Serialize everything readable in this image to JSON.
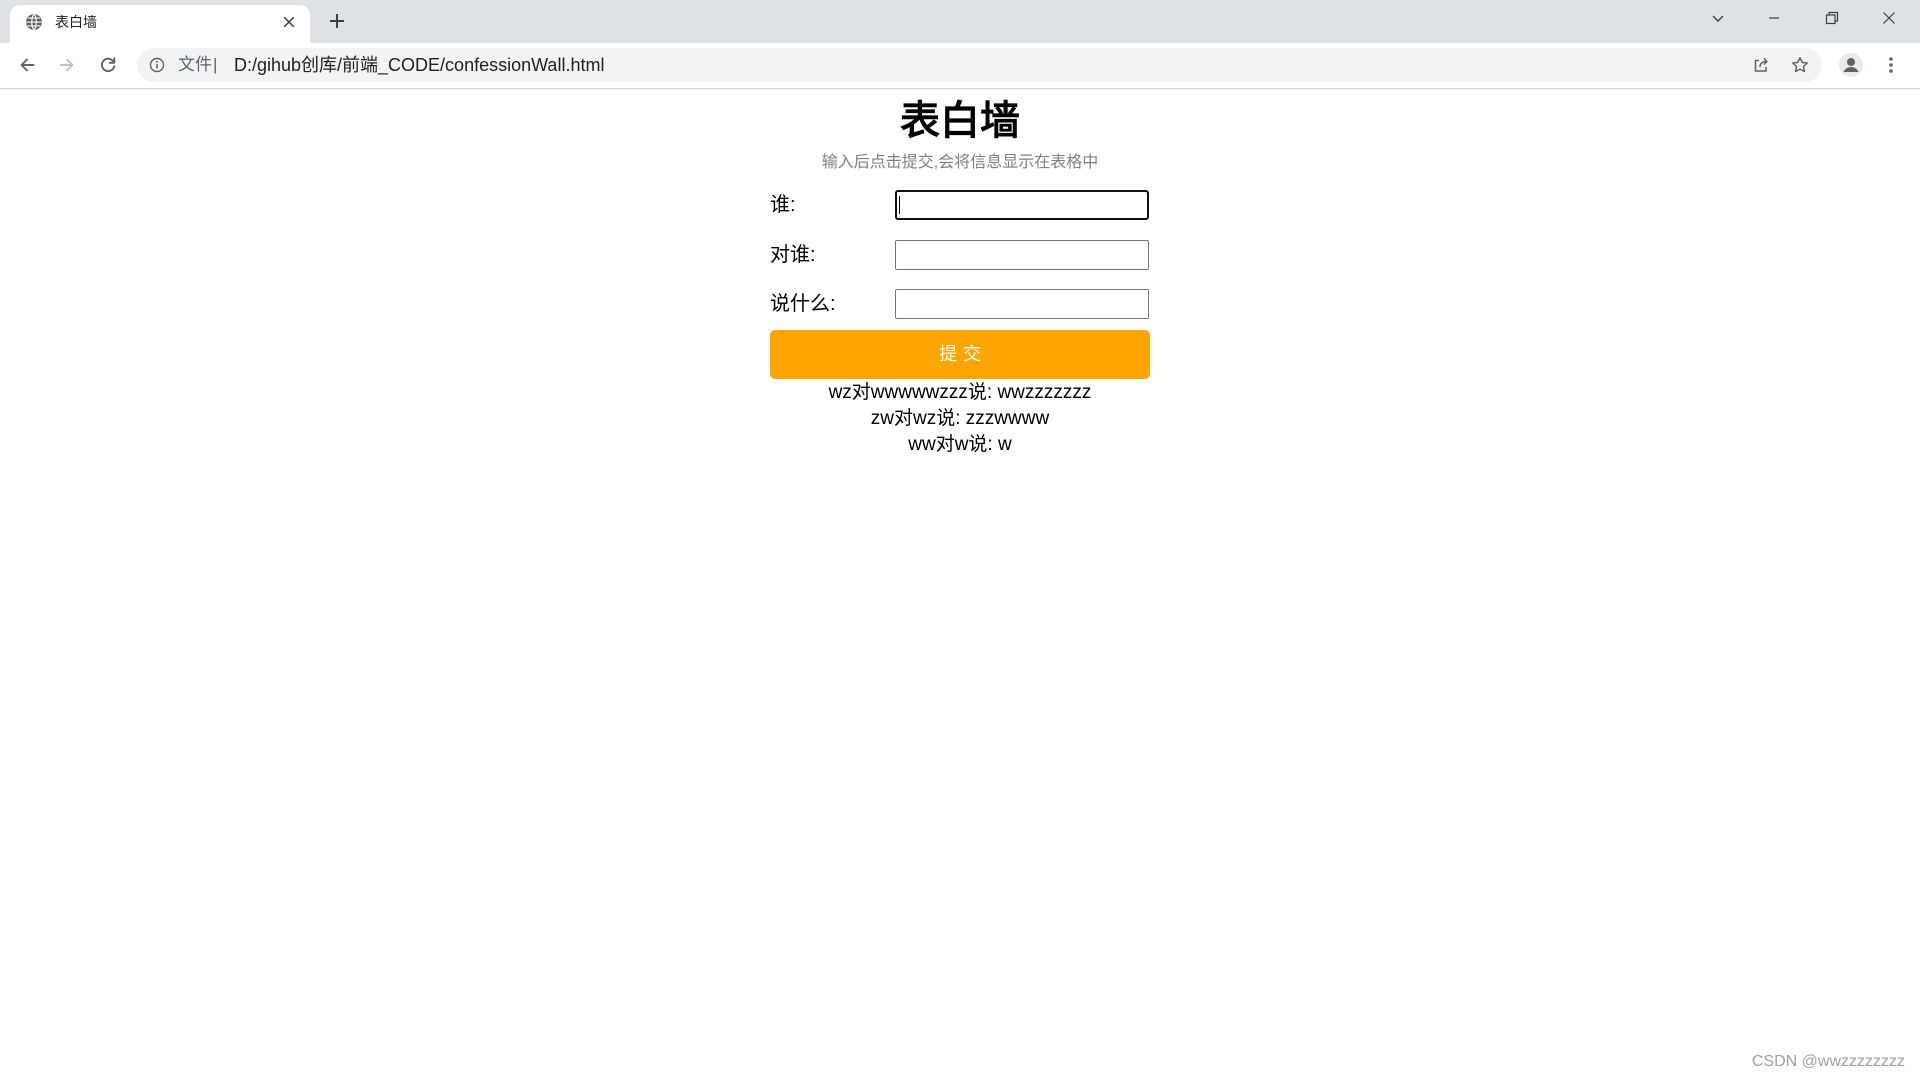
{
  "window": {
    "tab": {
      "title": "表白墙",
      "favicon": "globe-icon",
      "close_icon": "close-icon"
    },
    "new_tab_icon": "plus-icon",
    "controls": [
      "chevron-down-icon",
      "minimize-icon",
      "restore-icon",
      "window-close-icon"
    ]
  },
  "toolbar": {
    "nav_icons": [
      "back-arrow-icon",
      "forward-arrow-icon",
      "reload-icon"
    ],
    "omnibox": {
      "info_icon": "info-icon",
      "scheme_label": "文件",
      "separator": "|",
      "url": "D:/gihub创库/前端_CODE/confessionWall.html",
      "action_icons": [
        "share-icon",
        "star-icon"
      ]
    },
    "right_icons": [
      "profile-icon",
      "kebab-menu-icon"
    ]
  },
  "page": {
    "title": "表白墙",
    "subtitle": "输入后点击提交,会将信息显示在表格中",
    "form": {
      "fields": [
        {
          "label": "谁:",
          "value": ""
        },
        {
          "label": "对谁:",
          "value": ""
        },
        {
          "label": "说什么:",
          "value": ""
        }
      ],
      "submit_label": "提交"
    },
    "messages": [
      "wz对wwwwwzzz说: wwzzzzzzz",
      "zw对wz说: zzzwwww",
      "ww对w说: w"
    ]
  },
  "watermark": "CSDN @wwzzzzzzzz",
  "colors": {
    "submit_background": "#FFA500",
    "submit_text": "#FFFFFF",
    "subtitle": "#808080",
    "tab_strip": "#DEE1E6",
    "omnibox": "#F1F3F4"
  }
}
